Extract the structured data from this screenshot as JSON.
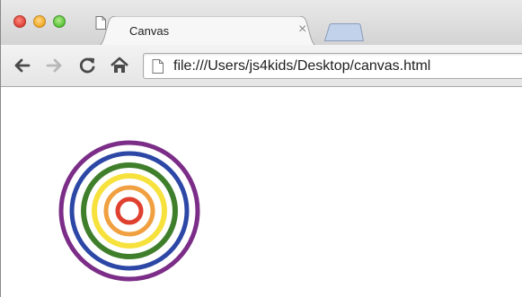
{
  "tab": {
    "title": "Canvas",
    "close": "×"
  },
  "address_bar": {
    "url": "file:///Users/js4kids/Desktop/canvas.html"
  },
  "canvas": {
    "center_label": "concentric circles",
    "rings": [
      {
        "color": "#7b2d88"
      },
      {
        "color": "#2c47a5"
      },
      {
        "color": "#3f7f2b"
      },
      {
        "color": "#f7e13c"
      },
      {
        "color": "#f0a040"
      },
      {
        "color": "#e0402f"
      }
    ]
  },
  "icons": {
    "back": "arrow-left-icon",
    "forward": "arrow-right-icon",
    "reload": "reload-icon",
    "home": "home-icon",
    "page": "page-icon"
  }
}
